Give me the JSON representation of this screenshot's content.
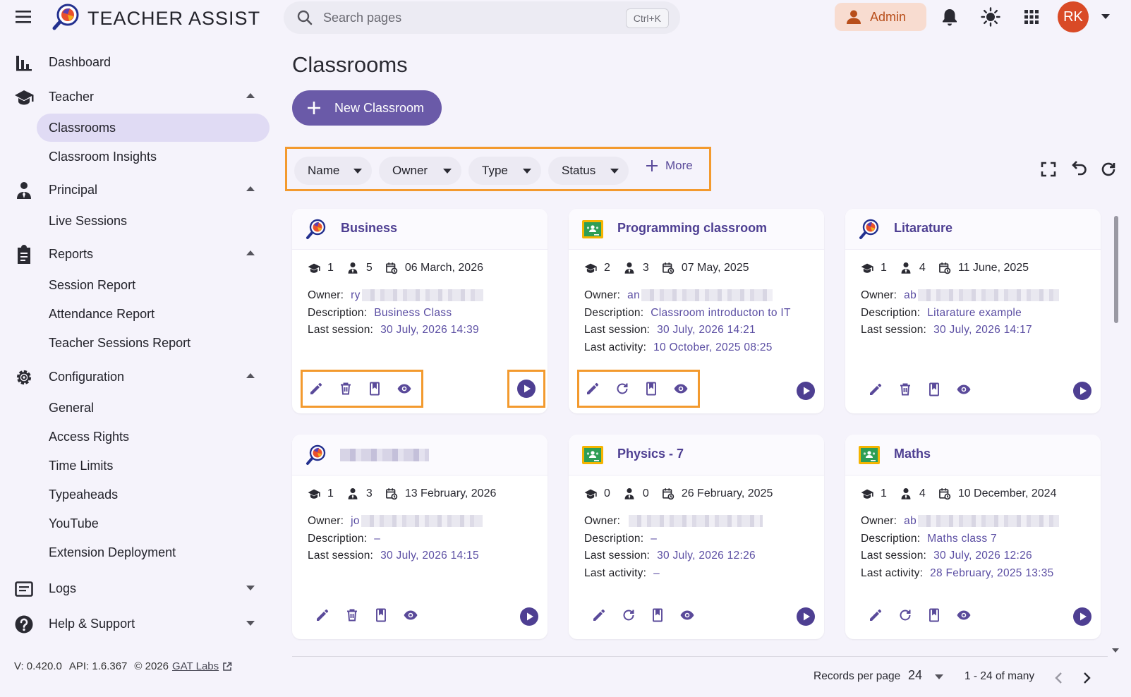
{
  "app": {
    "title": "TEACHER ASSIST"
  },
  "search": {
    "placeholder": "Search pages",
    "shortcut": "Ctrl+K"
  },
  "header": {
    "role_label": "Admin",
    "avatar_initials": "RK"
  },
  "colors": {
    "accent": "#6a5aa8",
    "highlight_frame": "#f39a2e",
    "admin_chip": "#f8dcd0",
    "avatar": "#d94a26"
  },
  "sidebar": {
    "items": [
      {
        "label": "Dashboard",
        "icon": "bar-chart-icon"
      },
      {
        "label": "Teacher",
        "icon": "graduation-cap-icon",
        "expanded": true,
        "children": [
          {
            "label": "Classrooms",
            "active": true
          },
          {
            "label": "Classroom Insights"
          }
        ]
      },
      {
        "label": "Principal",
        "icon": "person-tie-icon",
        "expanded": true,
        "children": [
          {
            "label": "Live Sessions"
          }
        ]
      },
      {
        "label": "Reports",
        "icon": "clipboard-icon",
        "expanded": true,
        "children": [
          {
            "label": "Session Report"
          },
          {
            "label": "Attendance Report"
          },
          {
            "label": "Teacher Sessions Report"
          }
        ]
      },
      {
        "label": "Configuration",
        "icon": "gear-icon",
        "expanded": true,
        "children": [
          {
            "label": "General"
          },
          {
            "label": "Access Rights"
          },
          {
            "label": "Time Limits"
          },
          {
            "label": "Typeaheads"
          },
          {
            "label": "YouTube"
          },
          {
            "label": "Extension Deployment"
          }
        ]
      },
      {
        "label": "Logs",
        "icon": "list-box-icon",
        "expanded": false
      },
      {
        "label": "Help & Support",
        "icon": "help-circle-icon",
        "expanded": false
      }
    ],
    "footer": {
      "version": "V: 0.420.0",
      "api": "API: 1.6.367",
      "copyright": "© 2026",
      "link": "GAT Labs"
    }
  },
  "main": {
    "title": "Classrooms",
    "new_button": "New Classroom",
    "filters": [
      "Name",
      "Owner",
      "Type",
      "Status"
    ],
    "more_label": "More"
  },
  "labels": {
    "owner": "Owner:",
    "description": "Description:",
    "last_session": "Last session:",
    "last_activity": "Last activity:"
  },
  "cards": [
    {
      "title": "Business",
      "logo": "teacher-assist-logo",
      "students": "1",
      "teachers": "5",
      "date": "06 March, 2026",
      "owner": "ry",
      "description": "Business Class",
      "last_session": "30 July, 2026 14:39",
      "actions": [
        "edit",
        "delete",
        "bookmark",
        "view"
      ]
    },
    {
      "title": "Programming classroom",
      "logo": "google-classroom-logo",
      "students": "2",
      "teachers": "3",
      "date": "07 May, 2025",
      "owner": "an",
      "description": "Classroom introducton to IT",
      "last_session": "30 July, 2026 14:21",
      "last_activity": "10 October, 2025 08:25",
      "actions": [
        "edit",
        "sync",
        "bookmark",
        "view"
      ]
    },
    {
      "title": "Litarature",
      "logo": "teacher-assist-logo",
      "students": "1",
      "teachers": "4",
      "date": "11 June, 2025",
      "owner": "ab",
      "description": "Litarature example",
      "last_session": "30 July, 2026 14:17",
      "actions": [
        "edit",
        "delete",
        "bookmark",
        "view"
      ]
    },
    {
      "title": "",
      "logo": "teacher-assist-logo",
      "students": "1",
      "teachers": "3",
      "date": "13 February, 2026",
      "owner": "jo",
      "description": "–",
      "last_session": "30 July, 2026 14:15",
      "actions": [
        "edit",
        "delete",
        "bookmark",
        "view"
      ]
    },
    {
      "title": "Physics - 7",
      "logo": "google-classroom-logo",
      "students": "0",
      "teachers": "0",
      "date": "26 February, 2025",
      "owner": "",
      "description": "–",
      "last_session": "30 July, 2026 12:26",
      "last_activity": "–",
      "actions": [
        "edit",
        "sync",
        "bookmark",
        "view"
      ]
    },
    {
      "title": "Maths",
      "logo": "google-classroom-logo",
      "students": "1",
      "teachers": "4",
      "date": "10 December, 2024",
      "owner": "ab",
      "description": "Maths class 7",
      "last_session": "30 July, 2026 12:26",
      "last_activity": "28 February, 2025 13:35",
      "actions": [
        "edit",
        "sync",
        "bookmark",
        "view"
      ]
    }
  ],
  "pagination": {
    "records_label": "Records per page",
    "per_page": "24",
    "range": "1 - 24 of many"
  }
}
